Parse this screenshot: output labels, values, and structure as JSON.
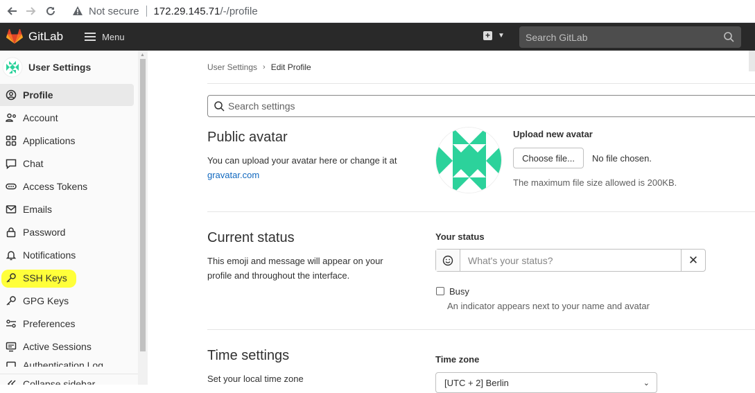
{
  "browser": {
    "security_label": "Not secure",
    "url_host": "172.29.145.71",
    "url_path": "/-/profile"
  },
  "topnav": {
    "brand": "GitLab",
    "menu_label": "Menu",
    "search_placeholder": "Search GitLab"
  },
  "sidebar": {
    "title": "User Settings",
    "items": [
      {
        "label": "Profile",
        "icon": "profile-icon",
        "active": true
      },
      {
        "label": "Account",
        "icon": "account-icon"
      },
      {
        "label": "Applications",
        "icon": "applications-icon"
      },
      {
        "label": "Chat",
        "icon": "chat-icon"
      },
      {
        "label": "Access Tokens",
        "icon": "token-icon"
      },
      {
        "label": "Emails",
        "icon": "mail-icon"
      },
      {
        "label": "Password",
        "icon": "lock-icon"
      },
      {
        "label": "Notifications",
        "icon": "bell-icon"
      },
      {
        "label": "SSH Keys",
        "icon": "key-icon",
        "highlighted": true
      },
      {
        "label": "GPG Keys",
        "icon": "key-icon"
      },
      {
        "label": "Preferences",
        "icon": "preferences-icon"
      },
      {
        "label": "Active Sessions",
        "icon": "sessions-icon"
      },
      {
        "label": "Authentication Log",
        "icon": "log-icon"
      }
    ],
    "collapse_label": "Collapse sidebar",
    "highlight_color": "#ffff3a"
  },
  "breadcrumb": {
    "parent": "User Settings",
    "current": "Edit Profile"
  },
  "settings_search": {
    "placeholder": "Search settings"
  },
  "public_avatar": {
    "title": "Public avatar",
    "desc_prefix": "You can upload your avatar here or change it at",
    "desc_link": "gravatar.com",
    "upload_label": "Upload new avatar",
    "choose_button": "Choose file...",
    "no_file": "No file chosen.",
    "max_size": "The maximum file size allowed is 200KB.",
    "identicon_color": "#2cd29b"
  },
  "current_status": {
    "title": "Current status",
    "desc": "This emoji and message will appear on your profile and throughout the interface.",
    "your_status_label": "Your status",
    "status_placeholder": "What's your status?",
    "busy_label": "Busy",
    "busy_help": "An indicator appears next to your name and avatar"
  },
  "time_settings": {
    "title": "Time settings",
    "desc": "Set your local time zone",
    "tz_label": "Time zone",
    "tz_value": "[UTC + 2] Berlin"
  }
}
